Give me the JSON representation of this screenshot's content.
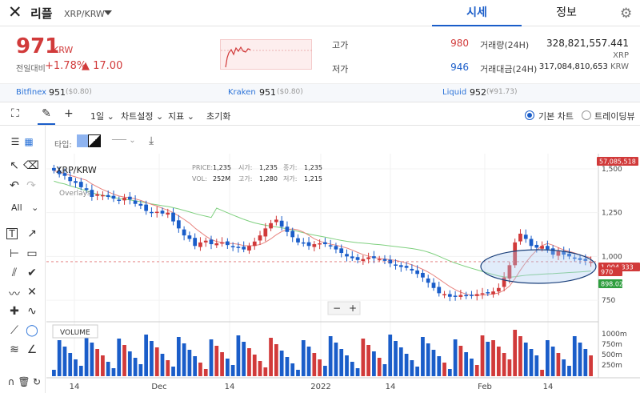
{
  "header": {
    "logo_icon": "x-logo-icon",
    "coin_name": "리플",
    "pair": "XRP/KRW",
    "tabs": [
      "시세",
      "정보"
    ],
    "settings_icon": "gear-icon"
  },
  "price": {
    "current": "971",
    "unit": "KRW",
    "change_label": "전일대비",
    "change_pct": "+1.78%",
    "change_abs": "▲ 17.00",
    "high_label": "고가",
    "high": "980",
    "low_label": "저가",
    "low": "946",
    "volume_label": "거래량(24H)",
    "volume": "328,821,557.441",
    "volume_unit": "XRP",
    "amount_label": "거래대금(24H)",
    "amount": "317,084,810,653",
    "amount_unit": "KRW"
  },
  "exchanges": [
    {
      "name": "Bitfinex",
      "price": "951",
      "sub": "($0.80)"
    },
    {
      "name": "Kraken",
      "price": "951",
      "sub": "($0.80)"
    },
    {
      "name": "Liquid",
      "price": "952",
      "sub": "(¥91.73)"
    }
  ],
  "toolbar": {
    "interval": "1일",
    "chart_settings": "차트설정",
    "indicators": "지표",
    "reset": "초기화",
    "basic_chart": "기본 차트",
    "trading_view": "트레이딩뷰"
  },
  "left_tools": {
    "all_label": "All"
  },
  "chart_header": {
    "type_label": "타입:",
    "title": "XRP/KRW",
    "overlays": "Overlays",
    "volume_label": "VOLUME",
    "price_label": "PRICE:",
    "price": "1,235",
    "vol_label": "VOL:",
    "vol": "252M",
    "open_label": "시가:",
    "open": "1,235",
    "high_label": "고가:",
    "high": "1,280",
    "close_label": "종가:",
    "close": "1,235",
    "low_label": "저가:",
    "low": "1,215"
  },
  "chart_data": {
    "type": "candlestick",
    "title": "XRP/KRW",
    "x_ticks": [
      "14",
      "Dec",
      "14",
      "2022",
      "14",
      "Feb",
      "14"
    ],
    "y_ticks": [
      "1,500",
      "1,250",
      "1,000",
      "750"
    ],
    "volume_ticks": [
      "1000m",
      "750m",
      "500m",
      "250m"
    ],
    "ylim": [
      650,
      1550
    ],
    "price_flags": [
      {
        "label": "57,085,518",
        "color": "#d13a3a"
      },
      {
        "label": "1,004,333",
        "color": "#d13a3a"
      },
      {
        "label": "970",
        "color": "#d13a3a"
      },
      {
        "label": "898.02",
        "color": "#2e9e3e"
      }
    ],
    "ma_colors": {
      "fast": "#e8847f",
      "slow": "#7fd07f"
    },
    "up_color": "#d13a3a",
    "down_color": "#1a5dc9"
  }
}
